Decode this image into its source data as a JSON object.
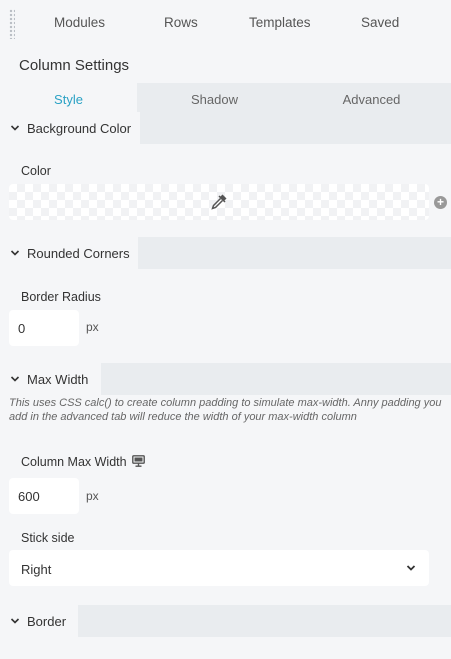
{
  "top_tabs": [
    "Modules",
    "Rows",
    "Templates",
    "Saved"
  ],
  "panel_title": "Column Settings",
  "settings_tabs": [
    "Style",
    "Shadow",
    "Advanced"
  ],
  "active_tab": "Style",
  "sections": {
    "background": {
      "title": "Background Color",
      "color_label": "Color"
    },
    "rounded": {
      "title": "Rounded Corners",
      "radius_label": "Border Radius",
      "radius_value": "0",
      "radius_unit": "px"
    },
    "max_width": {
      "title": "Max Width",
      "help_text": "This uses CSS calc() to create column padding to simulate max-width. Anny padding you add in the advanced tab will reduce the width of your max-width column",
      "width_label": "Column Max Width",
      "width_value": "600",
      "width_unit": "px",
      "stick_label": "Stick side",
      "stick_value": "Right"
    },
    "border": {
      "title": "Border"
    }
  },
  "colors": {
    "accent": "#2ba2c5",
    "background": "#f5f6f8",
    "section_header": "#e9ecef"
  },
  "icons": [
    "drag-handle-icon",
    "chevron-down-icon",
    "color-picker-icon",
    "plus-icon",
    "monitor-icon",
    "caret-down-icon"
  ]
}
